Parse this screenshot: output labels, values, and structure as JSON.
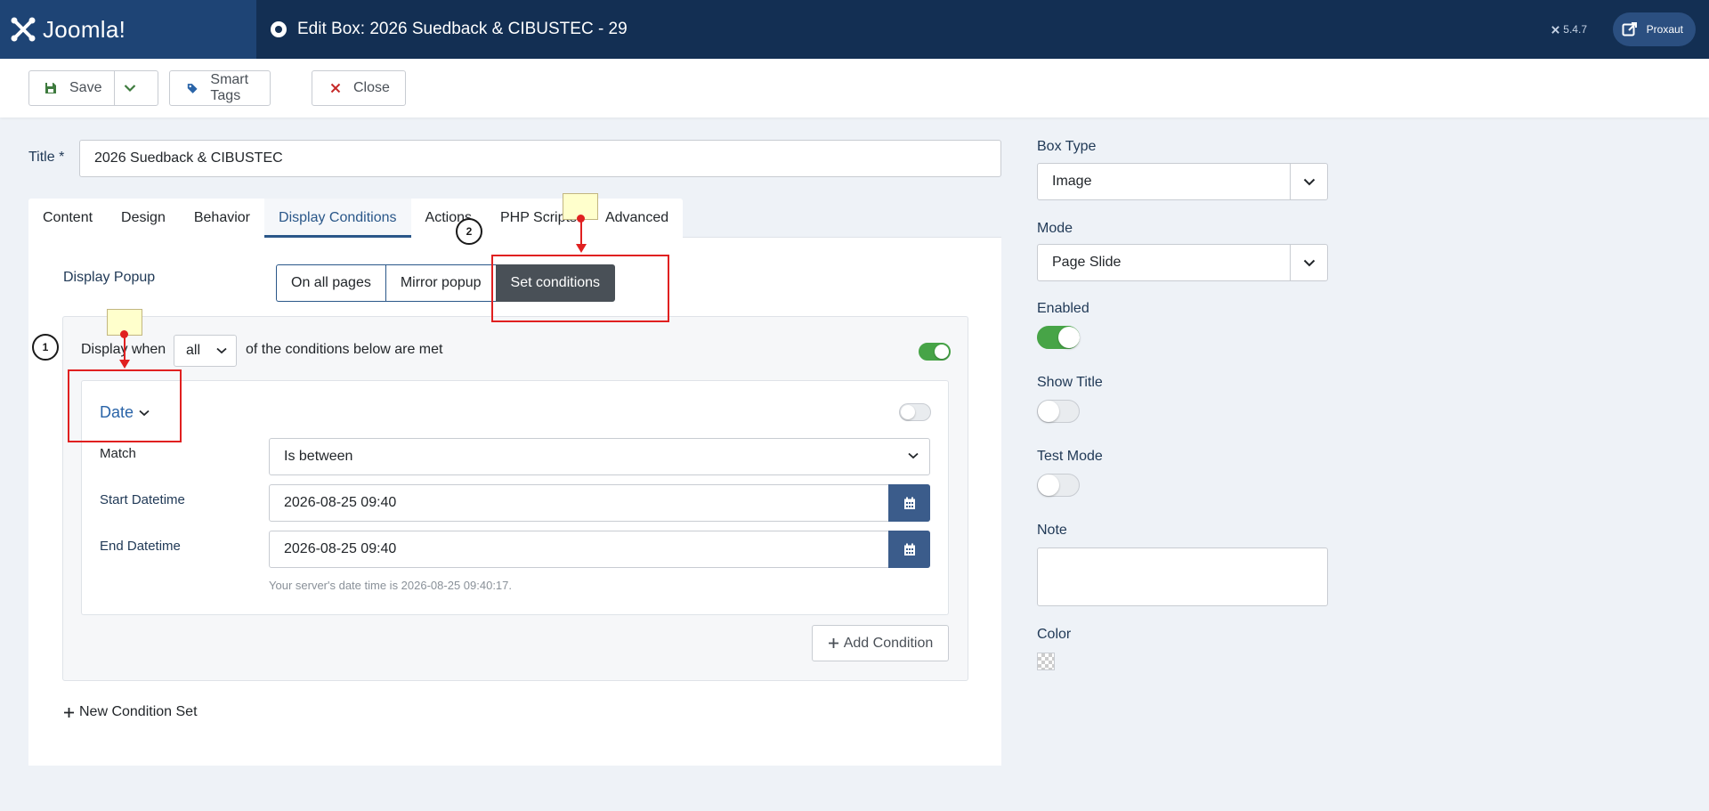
{
  "header": {
    "logo_text": "Joomla!",
    "title": "Edit Box: 2026 Suedback & CIBUSTEC - 29",
    "version": "5.4.7",
    "user": "Proxaut"
  },
  "toolbar": {
    "save_label": "Save",
    "smart_tags_label": "Smart Tags",
    "close_label": "Close"
  },
  "form": {
    "title_label": "Title *",
    "title_value": "2026 Suedback & CIBUSTEC"
  },
  "tabs": [
    {
      "label": "Content",
      "active": false
    },
    {
      "label": "Design",
      "active": false
    },
    {
      "label": "Behavior",
      "active": false
    },
    {
      "label": "Display Conditions",
      "active": true
    },
    {
      "label": "Actions",
      "active": false
    },
    {
      "label": "PHP Scripts",
      "active": false
    },
    {
      "label": "Advanced",
      "active": false
    }
  ],
  "display_popup": {
    "label": "Display Popup",
    "options": [
      "On all pages",
      "Mirror popup",
      "Set conditions"
    ],
    "selected": "Set conditions"
  },
  "condition_set": {
    "prefix": "Display when",
    "match_value": "all",
    "suffix": "of the conditions below are met",
    "enabled": true
  },
  "condition": {
    "title": "Date",
    "enabled": false,
    "match_label": "Match",
    "match_value": "Is between",
    "start_label": "Start Datetime",
    "start_value": "2026-08-25 09:40",
    "end_label": "End Datetime",
    "end_value": "2026-08-25 09:40",
    "hint": "Your server's date time is 2026-08-25 09:40:17.",
    "add_label": "Add Condition"
  },
  "new_set_label": "New Condition Set",
  "sidebar": {
    "box_type_label": "Box Type",
    "box_type_value": "Image",
    "mode_label": "Mode",
    "mode_value": "Page Slide",
    "enabled_label": "Enabled",
    "enabled": true,
    "show_title_label": "Show Title",
    "show_title": false,
    "test_mode_label": "Test Mode",
    "test_mode": false,
    "note_label": "Note",
    "note_value": "",
    "color_label": "Color"
  },
  "annotations": {
    "marker_1": "1",
    "marker_2": "2"
  },
  "colors": {
    "header_bg": "#132f53",
    "accent": "#2a5789",
    "success": "#47a447",
    "annotation": "#e02020"
  }
}
